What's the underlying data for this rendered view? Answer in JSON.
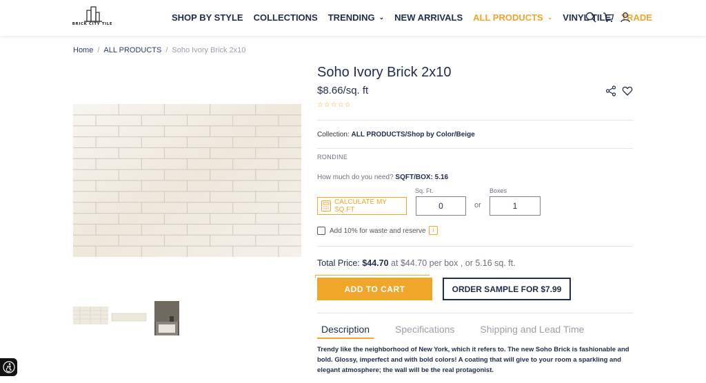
{
  "brand": {
    "logo_text": "BRICK CITY TILE"
  },
  "nav": {
    "items": [
      {
        "label": "SHOP BY STYLE",
        "dropdown": false,
        "highlight": false
      },
      {
        "label": "COLLECTIONS",
        "dropdown": false,
        "highlight": false
      },
      {
        "label": "TRENDING",
        "dropdown": true,
        "highlight": false
      },
      {
        "label": "NEW ARRIVALS",
        "dropdown": false,
        "highlight": false
      },
      {
        "label": "ALL PRODUCTS",
        "dropdown": true,
        "highlight": true
      },
      {
        "label": "VINYL TILE",
        "dropdown": false,
        "highlight": false
      },
      {
        "label": "TRADE",
        "dropdown": false,
        "highlight": true
      }
    ],
    "icons": [
      "search-icon",
      "cart-icon",
      "account-icon"
    ]
  },
  "breadcrumb": {
    "home": "Home",
    "sep": "/",
    "category": "ALL PRODUCTS",
    "current": "Soho Ivory Brick 2x10"
  },
  "product": {
    "title": "Soho Ivory Brick 2x10",
    "price": "$8.66/sq. ft",
    "stars": "☆☆☆☆☆",
    "rating": 0,
    "collection_label": "Collection:",
    "collection_value": "ALL PRODUCTS/Shop by Color/Beige",
    "brand": "RONDINE",
    "need_label": "How much do you need?",
    "sqft_box": "SQFT/BOX: 5.16",
    "calc_button": "CALCULATE MY SQ.FT",
    "sqft_label": "Sq. Ft.",
    "sqft_value": "0",
    "or": "or",
    "boxes_label": "Boxes",
    "boxes_value": "1",
    "waste_label": "Add 10% for waste and reserve",
    "info_glyph": "i",
    "total_label": "Total Price:",
    "total_amount": "$44.70",
    "total_rest": "at $44.70 per box , or 5.16 sq. ft.",
    "add_to_cart": "ADD TO CART",
    "order_sample": "ORDER SAMPLE FOR $7.99"
  },
  "tabs": [
    {
      "label": "Description",
      "active": true
    },
    {
      "label": "Specifications",
      "active": false
    },
    {
      "label": "Shipping and Lead Time",
      "active": false
    }
  ],
  "description": "Trendy like the neighborhood of New York, which it refers to. The new Soho Brick is fashionable and bold. Glossy, imperfect and with bold colors! A coating that will give to your room a sparkling and elegant atmosphere; the wall will be the real protagonist.",
  "colors": {
    "navy": "#1f2d4a",
    "accent": "#f0a52b",
    "muted": "#9aa0aa"
  }
}
